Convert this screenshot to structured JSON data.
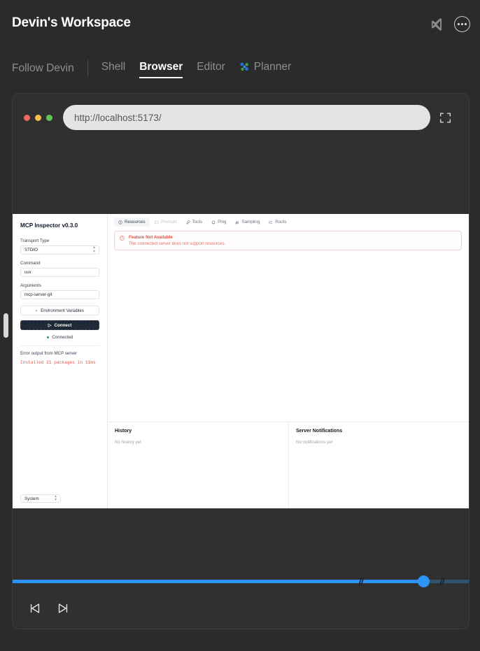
{
  "header": {
    "title": "Devin's Workspace",
    "vscode_icon": "vscode-icon",
    "more_icon": "more-options-icon"
  },
  "tabs": {
    "follow_label": "Follow Devin",
    "items": [
      {
        "label": "Shell",
        "active": false
      },
      {
        "label": "Browser",
        "active": true
      },
      {
        "label": "Editor",
        "active": false
      },
      {
        "label": "Planner",
        "active": false,
        "icon": "planner-cluster-icon"
      }
    ]
  },
  "browser": {
    "url": "http://localhost:5173/",
    "url_placeholder": "http://localhost:5173/",
    "expand_icon": "fullscreen-icon",
    "traffic_colors": {
      "red": "#ed6a5f",
      "yellow": "#f4be4f",
      "green": "#61c554"
    }
  },
  "mcp": {
    "title": "MCP Inspector v0.3.0",
    "transport_label": "Transport Type",
    "transport_value": "STDIO",
    "command_label": "Command",
    "command_value": "uvx",
    "arguments_label": "Arguments",
    "arguments_value": "mcp-server-git",
    "env_button": "Environment Variables",
    "connect_button": "Connect",
    "connection_status": "Connected",
    "error_label": "Error output from MCP server",
    "error_text": "Installed 21 packages in 11ms",
    "system_select": "System",
    "tabs": [
      {
        "label": "Resources",
        "icon": "resources-icon",
        "state": "active"
      },
      {
        "label": "Prompts",
        "icon": "prompts-icon",
        "state": "dim"
      },
      {
        "label": "Tools",
        "icon": "tools-icon",
        "state": "normal"
      },
      {
        "label": "Ping",
        "icon": "ping-icon",
        "state": "normal"
      },
      {
        "label": "Sampling",
        "icon": "sampling-icon",
        "state": "normal"
      },
      {
        "label": "Roots",
        "icon": "roots-icon",
        "state": "normal"
      }
    ],
    "alert": {
      "icon": "alert-circle-icon",
      "title": "Feature Not Available",
      "body": "The connected server does not support resources."
    },
    "history": {
      "title": "History",
      "empty": "No history yet"
    },
    "notifications": {
      "title": "Server Notifications",
      "empty": "No notifications yet"
    }
  },
  "player": {
    "progress_percent": 90,
    "accent_color": "#2e93f7",
    "track_color": "#2f5472",
    "prev_icon": "skip-previous-icon",
    "next_icon": "skip-next-icon"
  }
}
